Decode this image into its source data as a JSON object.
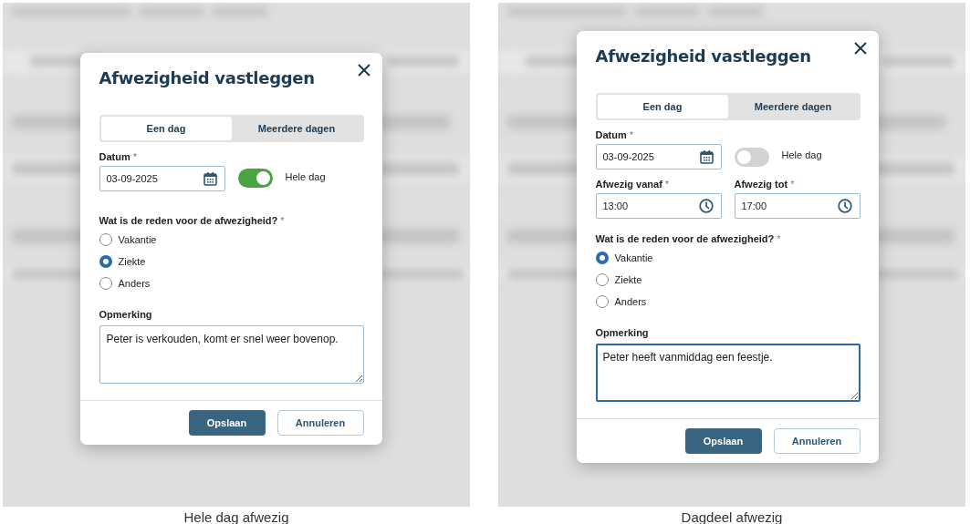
{
  "screens": [
    {
      "caption": "Hele dag afwezig",
      "dialog": {
        "title": "Afwezigheid vastleggen",
        "tabs": [
          {
            "label": "Een dag",
            "selected": true
          },
          {
            "label": "Meerdere dagen",
            "selected": false
          }
        ],
        "date_field": {
          "label": "Datum",
          "required_mark": "*",
          "value": "03-09-2025"
        },
        "toggle": {
          "label": "Hele dag",
          "on": true
        },
        "question": {
          "label": "Wat is de reden voor de afwezigheid?",
          "required_mark": "*"
        },
        "options": [
          {
            "label": "Vakantie",
            "selected": false
          },
          {
            "label": "Ziekte",
            "selected": true
          },
          {
            "label": "Anders",
            "selected": false
          }
        ],
        "remark": {
          "label": "Opmerking",
          "value": "Peter is verkouden, komt er snel weer bovenop.",
          "focused": false
        },
        "buttons": [
          {
            "label": "Opslaan",
            "kind": "primary"
          },
          {
            "label": "Annuleren",
            "kind": "secondary"
          }
        ]
      }
    },
    {
      "caption": "Dagdeel afwezig",
      "dialog": {
        "title": "Afwezigheid vastleggen",
        "tabs": [
          {
            "label": "Een dag",
            "selected": true
          },
          {
            "label": "Meerdere dagen",
            "selected": false
          }
        ],
        "date_field": {
          "label": "Datum",
          "required_mark": "*",
          "value": "03-09-2025"
        },
        "toggle": {
          "label": "Hele dag",
          "on": false
        },
        "time_fields": [
          {
            "label": "Afwezig vanaf",
            "required_mark": "*",
            "value": "13:00"
          },
          {
            "label": "Afwezig tot",
            "required_mark": "*",
            "value": "17:00"
          }
        ],
        "question": {
          "label": "Wat is de reden voor de afwezigheid?",
          "required_mark": "*"
        },
        "options": [
          {
            "label": "Vakantie",
            "selected": true
          },
          {
            "label": "Ziekte",
            "selected": false
          },
          {
            "label": "Anders",
            "selected": false
          }
        ],
        "remark": {
          "label": "Opmerking",
          "value": "Peter heeft vanmiddag een feestje.",
          "focused": true
        },
        "buttons": [
          {
            "label": "Opslaan",
            "kind": "primary"
          },
          {
            "label": "Annuleren",
            "kind": "secondary"
          }
        ]
      }
    }
  ]
}
